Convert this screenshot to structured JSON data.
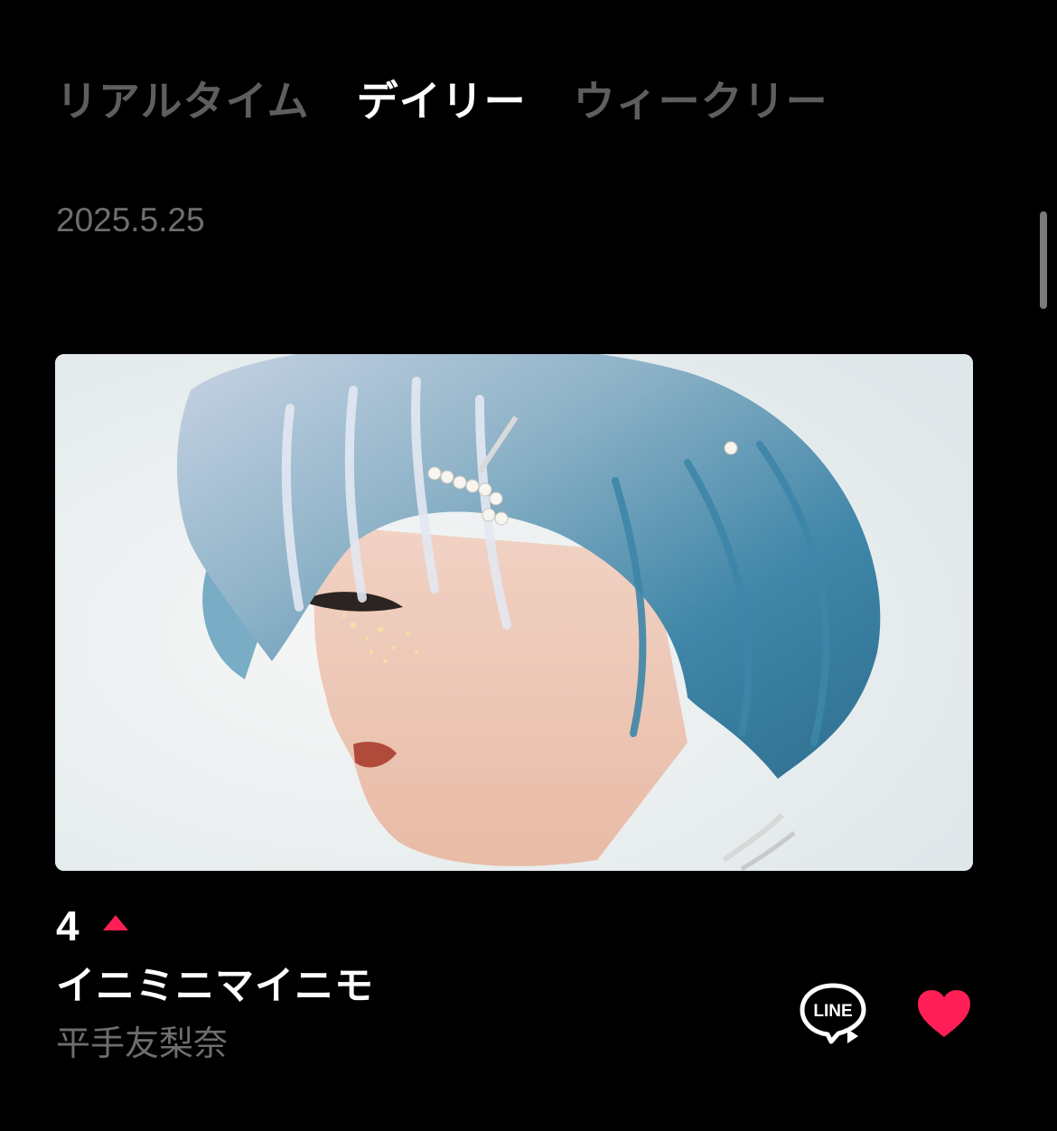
{
  "tabs": [
    {
      "label": "リアルタイム",
      "active": false
    },
    {
      "label": "デイリー",
      "active": true
    },
    {
      "label": "ウィークリー",
      "active": false
    }
  ],
  "chart_date": "2025.5.25",
  "entry": {
    "rank": "4",
    "rank_change": "up",
    "title": "イニミニマイニモ",
    "artist": "平手友梨奈",
    "share_icon_label": "LINE",
    "accent_color": "#ff1e56"
  }
}
